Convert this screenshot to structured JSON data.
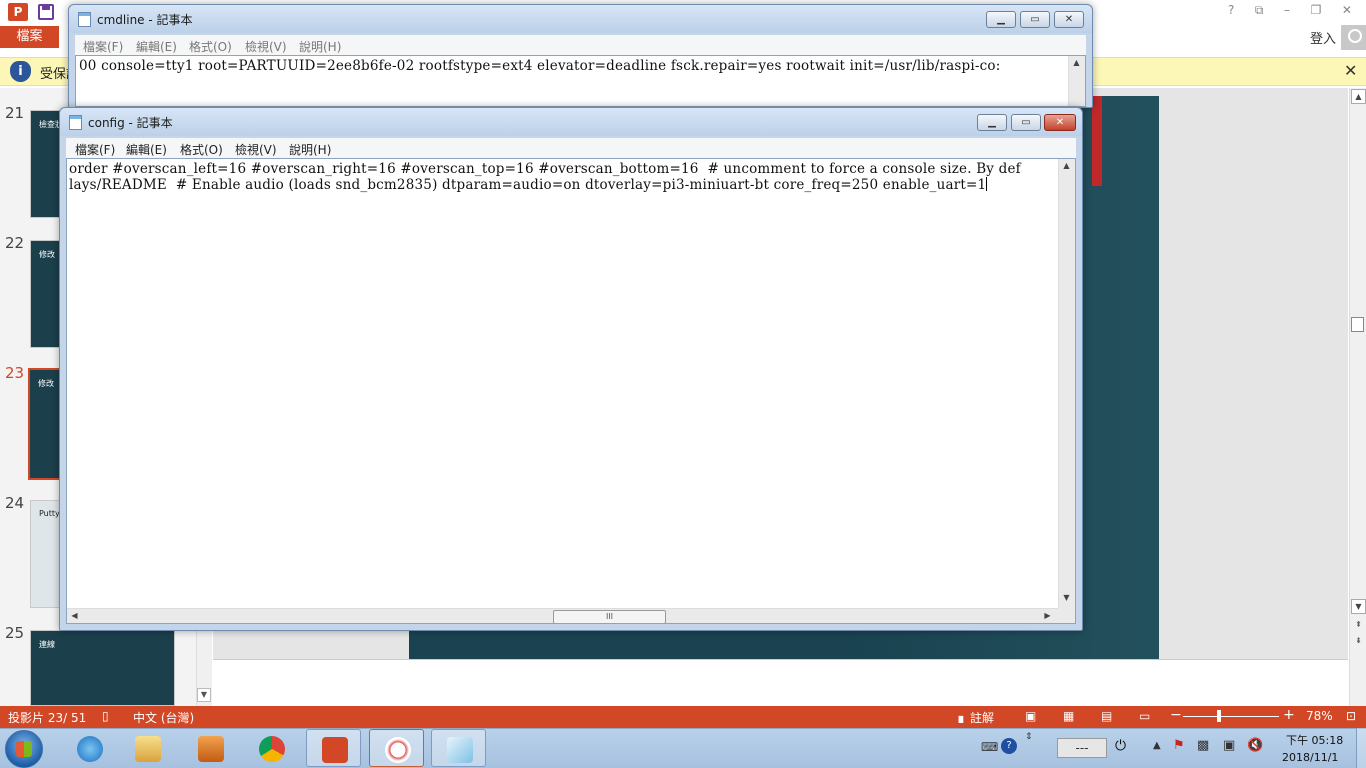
{
  "powerpoint": {
    "file_tab": "檔案",
    "login": "登入",
    "title_controls": [
      "?",
      "⧉",
      "–",
      "❐",
      "✕"
    ],
    "info_bar_text": "受保護",
    "thumbnails": [
      {
        "number": "21",
        "title": "檢查狀"
      },
      {
        "number": "22",
        "title": "修改"
      },
      {
        "number": "23",
        "title": "修改"
      },
      {
        "number": "24",
        "title": "Putty"
      },
      {
        "number": "25",
        "title": "連線"
      }
    ],
    "status_bar": {
      "slide_info": "投影片 23/ 51",
      "language": "中文 (台灣)",
      "notes": "註解",
      "zoom": "78%",
      "zoom_minus": "−",
      "zoom_plus": "+"
    },
    "accent_color": "#d24726"
  },
  "cmdline_window": {
    "title": "cmdline - 記事本",
    "menu": [
      "檔案(F)",
      "編輯(E)",
      "格式(O)",
      "檢視(V)",
      "說明(H)"
    ],
    "content": "00 console=tty1 root=PARTUUID=2ee8b6fe-02 rootfstype=ext4 elevator=deadline fsck.repair=yes rootwait init=/usr/lib/raspi-co:"
  },
  "config_window": {
    "title": "config - 記事本",
    "menu": [
      "檔案(F)",
      "編輯(E)",
      "格式(O)",
      "檢視(V)",
      "說明(H)"
    ],
    "lines": [
      "order #overscan_left=16 #overscan_right=16 #overscan_top=16 #overscan_bottom=16  # uncomment to force a console size. By def",
      "lays/README  # Enable audio (loads snd_bcm2835) dtparam=audio=on dtoverlay=pi3-miniuart-bt core_freq=250 enable_uart=1"
    ],
    "hscroll_grip": "III"
  },
  "taskbar": {
    "apps": [
      "explorer-icon",
      "ie-icon",
      "file-manager-icon",
      "media-player-icon",
      "chrome-icon",
      "powerpoint-icon",
      "snipping-tool-icon",
      "notepad-icon"
    ],
    "battery_text": "---",
    "time": "下午 05:18",
    "date": "2018/11/1"
  }
}
